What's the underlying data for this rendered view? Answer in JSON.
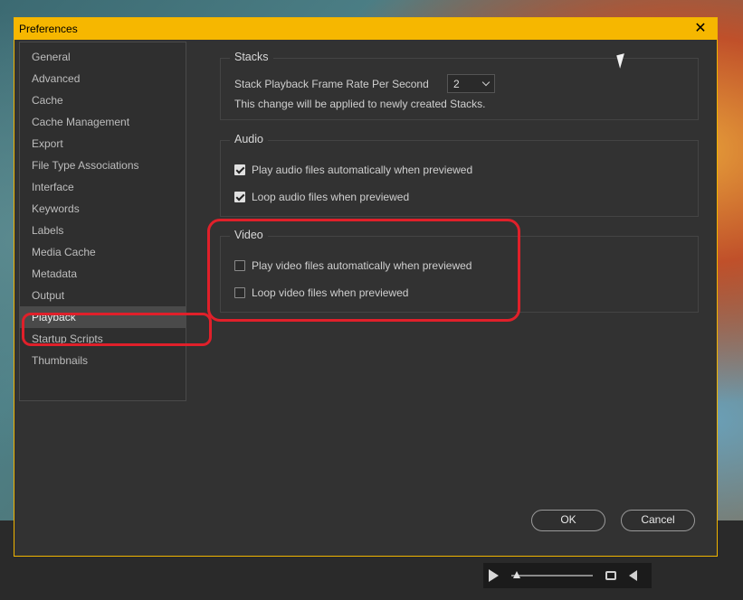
{
  "window": {
    "title": "Preferences"
  },
  "sidebar": {
    "items": [
      {
        "label": "General"
      },
      {
        "label": "Advanced"
      },
      {
        "label": "Cache"
      },
      {
        "label": "Cache Management"
      },
      {
        "label": "Export"
      },
      {
        "label": "File Type Associations"
      },
      {
        "label": "Interface"
      },
      {
        "label": "Keywords"
      },
      {
        "label": "Labels"
      },
      {
        "label": "Media Cache"
      },
      {
        "label": "Metadata"
      },
      {
        "label": "Output"
      },
      {
        "label": "Playback",
        "selected": true
      },
      {
        "label": "Startup Scripts"
      },
      {
        "label": "Thumbnails"
      }
    ]
  },
  "stacks": {
    "title": "Stacks",
    "frame_rate_label": "Stack Playback Frame Rate Per Second",
    "frame_rate_value": "2",
    "note": "This change will be applied to newly created Stacks."
  },
  "audio": {
    "title": "Audio",
    "play_auto_label": "Play audio files automatically when previewed",
    "play_auto_checked": true,
    "loop_label": "Loop audio files when previewed",
    "loop_checked": true
  },
  "video": {
    "title": "Video",
    "play_auto_label": "Play video files automatically when previewed",
    "play_auto_checked": false,
    "loop_label": "Loop video files when previewed",
    "loop_checked": false
  },
  "buttons": {
    "ok": "OK",
    "cancel": "Cancel"
  },
  "colors": {
    "accent": "#f6b700",
    "annotation": "#e0202a",
    "dialog_bg": "#323232"
  },
  "icons": {
    "close": "close-icon",
    "dropdown": "chevron-down-icon"
  }
}
